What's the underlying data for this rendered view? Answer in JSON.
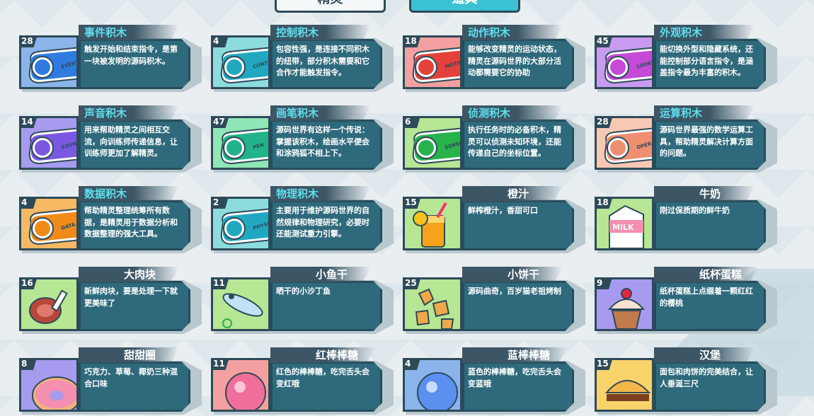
{
  "tabs": {
    "sprites": "精灵",
    "props": "道具"
  },
  "cards": [
    {
      "count": "28",
      "title": "事件积木",
      "desc": "触发开始和结束指令，是第一块被发明的源码积木。",
      "label": "EVENTS",
      "theme": "blue",
      "kind": "block"
    },
    {
      "count": "4",
      "title": "控制积木",
      "desc": "包容性强，是连接不同积木的纽带，部分积木需要和它合作才能触发指令。",
      "label": "CONTROL",
      "theme": "teal",
      "kind": "block"
    },
    {
      "count": "18",
      "title": "动作积木",
      "desc": "能够改变精灵的运动状态，精灵在源码世界的大部分活动都需要它的协助",
      "label": "MOTION",
      "theme": "red",
      "kind": "block"
    },
    {
      "count": "45",
      "title": "外观积木",
      "desc": "能切换外型和隐藏系统，还能控制部分语言指令，是涵盖指令最为丰富的积木。",
      "label": "LOOKS",
      "theme": "purple",
      "kind": "block"
    },
    {
      "count": "14",
      "title": "声音积木",
      "desc": "用来帮助精灵之间相互交流，向训练师传递信息，让训练师更加了解精灵。",
      "label": "SOUND",
      "theme": "violet",
      "kind": "block"
    },
    {
      "count": "47",
      "title": "画笔积木",
      "desc": "源码世界有这样一个传说：掌握该积木，绘画水平便会和涂鸦狐不相上下。",
      "label": "PEN",
      "theme": "green",
      "kind": "block"
    },
    {
      "count": "6",
      "title": "侦测积木",
      "desc": "执行任务时的必备积木，精灵可以侦测未知环境，还能传递自己的坐标位置。",
      "label": "SENSING",
      "theme": "lgreen",
      "kind": "block"
    },
    {
      "count": "28",
      "title": "运算积木",
      "desc": "源码世界最强的数学运算工具，帮助精灵解决计算方面的问题。",
      "label": "OPERATORS",
      "theme": "peach",
      "kind": "block"
    },
    {
      "count": "4",
      "title": "数据积木",
      "desc": "帮助精灵整理统筹所有数据，是精灵用于数据分析和数据整理的强大工具。",
      "label": "DATA",
      "theme": "orange",
      "kind": "block"
    },
    {
      "count": "2",
      "title": "物理积木",
      "desc": "主要用于维护源码世界的自然规律和物理研究，必要时还能测试重力引擎。",
      "label": "PHYSICS",
      "theme": "teal",
      "kind": "block"
    },
    {
      "count": "15",
      "title": "橙汁",
      "desc": "鲜榨橙汁，香甜可口",
      "label": "",
      "theme": "lgreen",
      "kind": "juice"
    },
    {
      "count": "18",
      "title": "牛奶",
      "desc": "刚过保质期的鲜牛奶",
      "label": "",
      "theme": "lgreen",
      "kind": "milk"
    },
    {
      "count": "16",
      "title": "大肉块",
      "desc": "新鲜肉块，要是处理一下就更美味了",
      "label": "",
      "theme": "lgreen",
      "kind": "meat"
    },
    {
      "count": "11",
      "title": "小鱼干",
      "desc": "晒干的小沙丁鱼",
      "label": "",
      "theme": "lgreen",
      "kind": "fish"
    },
    {
      "count": "25",
      "title": "小饼干",
      "desc": "源码曲奇，百岁猫老祖烤制",
      "label": "",
      "theme": "lgreen",
      "kind": "cookie"
    },
    {
      "count": "9",
      "title": "纸杯蛋糕",
      "desc": "纸杯蛋糕上点缀着一颗红红的樱桃",
      "label": "",
      "theme": "violet",
      "kind": "cupcake"
    },
    {
      "count": "8",
      "title": "甜甜圈",
      "desc": "巧克力、草莓、椰奶三种混合口味",
      "label": "",
      "theme": "violet",
      "kind": "donut"
    },
    {
      "count": "11",
      "title": "红棒棒糖",
      "desc": "红色的棒棒糖，吃完舌头会变红哦",
      "label": "",
      "theme": "red",
      "kind": "lollipop-red"
    },
    {
      "count": "4",
      "title": "蓝棒棒糖",
      "desc": "蓝色的棒棒糖，吃完舌头会变蓝哦",
      "label": "",
      "theme": "blue",
      "kind": "lollipop-blue"
    },
    {
      "count": "15",
      "title": "汉堡",
      "desc": "面包和肉饼的完美结合，让人垂涎三尺",
      "label": "",
      "theme": "gold",
      "kind": "burger"
    }
  ]
}
